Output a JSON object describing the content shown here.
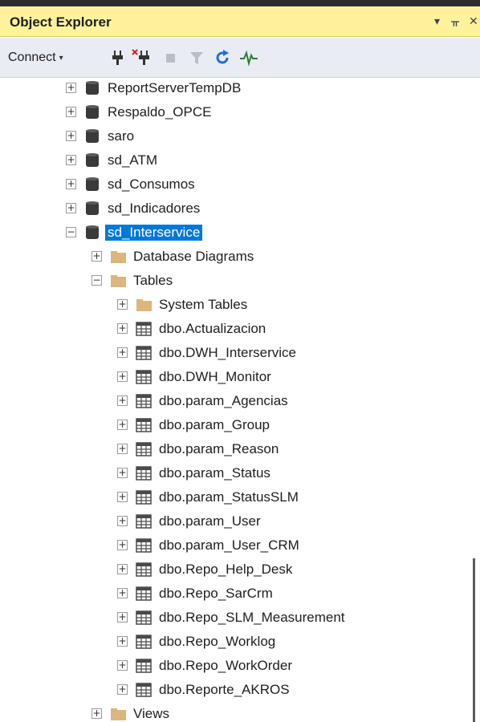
{
  "panel": {
    "title": "Object Explorer",
    "dropdown_glyph": "▾",
    "pin_glyph": "ᚂ",
    "close_glyph": "✕"
  },
  "toolbar": {
    "connect_label": "Connect",
    "caret": "▾",
    "icons": [
      "connect-plug-icon",
      "disconnect-plug-icon",
      "stop-icon",
      "filter-icon",
      "refresh-icon",
      "activity-monitor-icon"
    ]
  },
  "tree": {
    "expanded_glyph": "−",
    "collapsed_glyph": "+",
    "databases": [
      {
        "label": "ReportServerTempDB",
        "expanded": false
      },
      {
        "label": "Respaldo_OPCE",
        "expanded": false
      },
      {
        "label": "saro",
        "expanded": false
      },
      {
        "label": "sd_ATM",
        "expanded": false
      },
      {
        "label": "sd_Consumos",
        "expanded": false
      },
      {
        "label": "sd_Indicadores",
        "expanded": false
      },
      {
        "label": "sd_Interservice",
        "expanded": true,
        "selected": true
      }
    ],
    "db_children": [
      {
        "label": "Database Diagrams",
        "expanded": false
      },
      {
        "label": "Tables",
        "expanded": true
      }
    ],
    "system_tables": "System Tables",
    "tables": [
      "dbo.Actualizacion",
      "dbo.DWH_Interservice",
      "dbo.DWH_Monitor",
      "dbo.param_Agencias",
      "dbo.param_Group",
      "dbo.param_Reason",
      "dbo.param_Status",
      "dbo.param_StatusSLM",
      "dbo.param_User",
      "dbo.param_User_CRM",
      "dbo.Repo_Help_Desk",
      "dbo.Repo_SarCrm",
      "dbo.Repo_SLM_Measurement",
      "dbo.Repo_Worklog",
      "dbo.Repo_WorkOrder",
      "dbo.Reporte_AKROS"
    ],
    "views": "Views"
  },
  "colors": {
    "title_bg": "#fff29d",
    "toolbar_bg": "#e9ecf3",
    "selection": "#0078d7",
    "folder": "#dcb67a",
    "db_icon": "#3a3a3a",
    "table_icon": "#4a4a4a"
  }
}
